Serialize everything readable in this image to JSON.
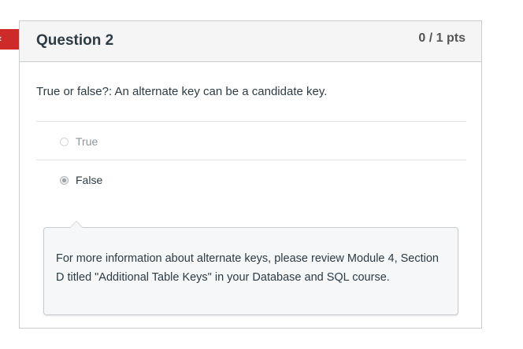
{
  "marker": {
    "icon": "chevron-left-icon",
    "glyph": "‹",
    "color": "#cf2a2a"
  },
  "question": {
    "title": "Question 2",
    "points": "0 / 1 pts",
    "text": "True or false?: An alternate key can be a candidate key.",
    "answers": [
      {
        "label": "True",
        "selected": false
      },
      {
        "label": "False",
        "selected": true
      }
    ]
  },
  "comment": {
    "text": "For more information about alternate keys, please review Module 4, Section D titled \"Additional Table Keys\" in your Database and SQL course."
  },
  "colors": {
    "text": "#2d3b45",
    "border": "#c7cdd1",
    "header_bg": "#f5f5f5",
    "comment_bg": "#f6f7f8"
  }
}
